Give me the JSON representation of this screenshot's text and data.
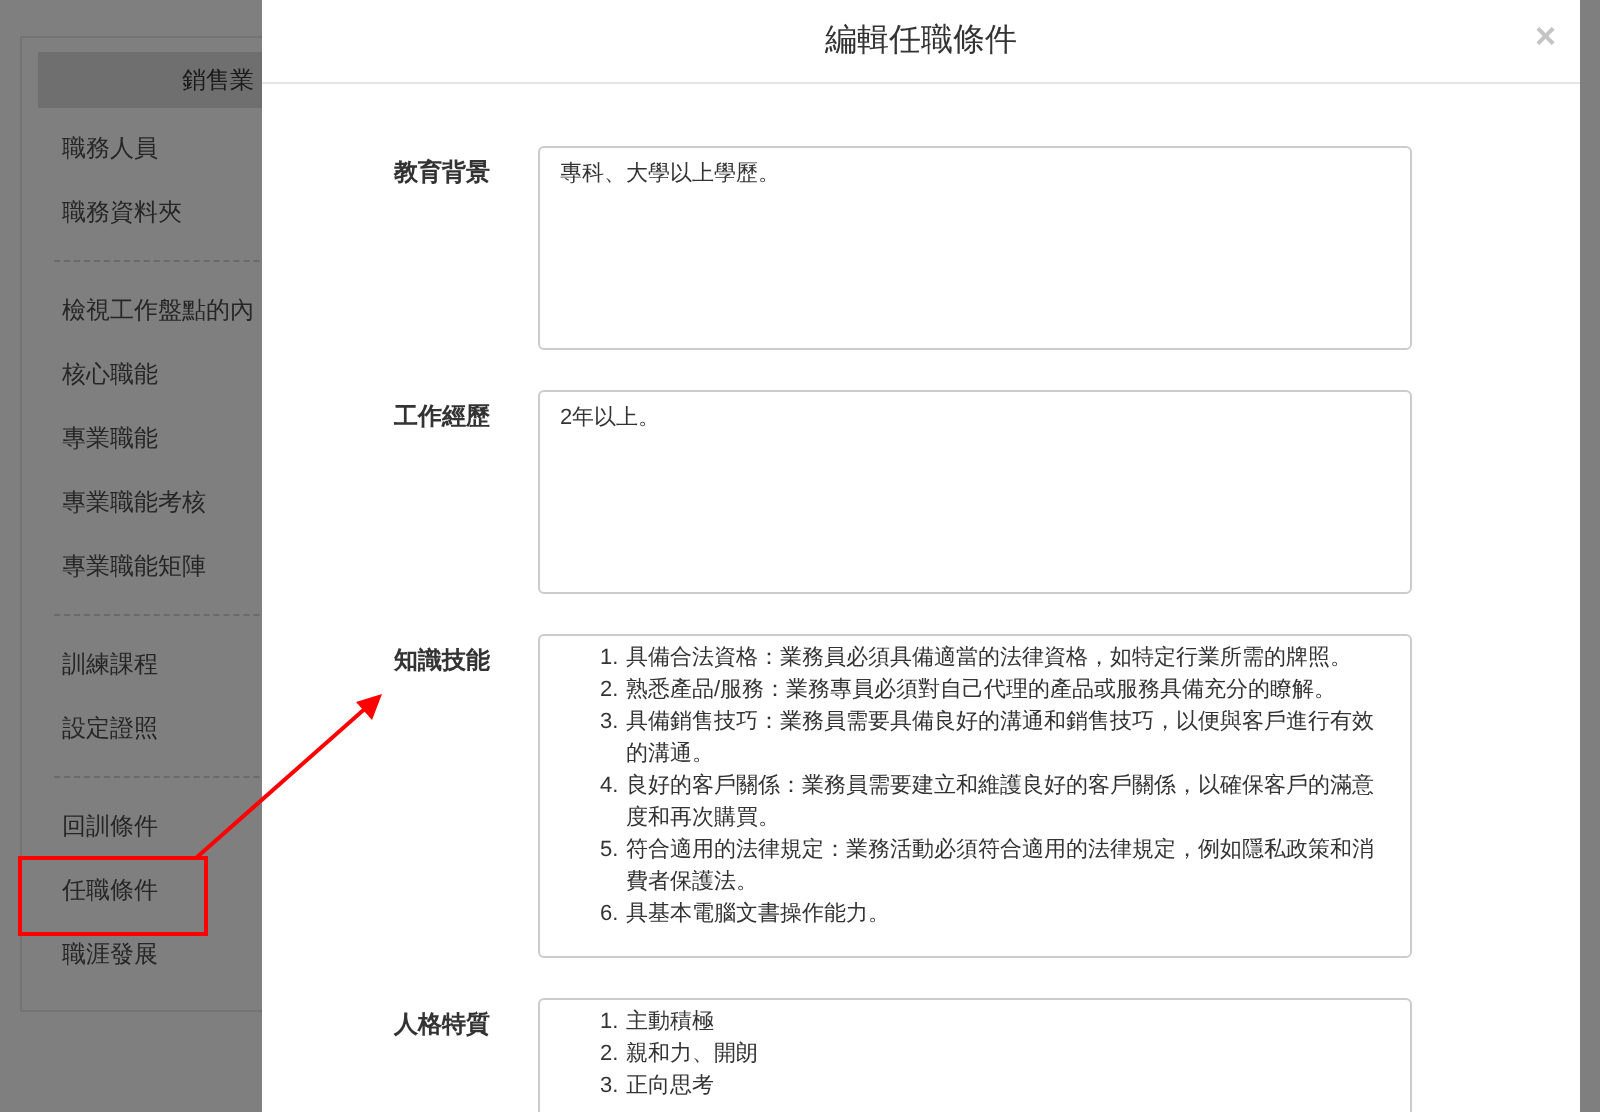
{
  "sidebar": {
    "header": "銷售業",
    "groups": [
      {
        "items": [
          {
            "label": "職務人員"
          },
          {
            "label": "職務資料夾"
          }
        ]
      },
      {
        "items": [
          {
            "label": "檢視工作盤點的內"
          },
          {
            "label": "核心職能"
          },
          {
            "label": "專業職能"
          },
          {
            "label": "專業職能考核"
          },
          {
            "label": "專業職能矩陣"
          }
        ]
      },
      {
        "items": [
          {
            "label": "訓練課程"
          },
          {
            "label": "設定證照"
          }
        ]
      },
      {
        "items": [
          {
            "label": "回訓條件"
          },
          {
            "label": "任職條件"
          },
          {
            "label": "職涯發展"
          }
        ]
      }
    ]
  },
  "modal": {
    "title": "編輯任職條件",
    "close": "×",
    "fields": [
      {
        "label": "教育背景",
        "kind": "text",
        "value": "專科、大學以上學歷。"
      },
      {
        "label": "工作經歷",
        "kind": "text",
        "value": "2年以上。"
      },
      {
        "label": "知識技能",
        "kind": "list",
        "items": [
          {
            "number": "1.",
            "text": "具備合法資格：業務員必須具備適當的法律資格，如特定行業所需的牌照。"
          },
          {
            "number": "2.",
            "text": "熟悉產品/服務：業務專員必須對自己代理的產品或服務具備充分的瞭解。"
          },
          {
            "number": "3.",
            "text": "具備銷售技巧：業務員需要具備良好的溝通和銷售技巧，以便與客戶進行有效的溝通。"
          },
          {
            "number": "4.",
            "text": "良好的客戶關係：業務員需要建立和維護良好的客戶關係，以確保客戶的滿意度和再次購買。"
          },
          {
            "number": "5.",
            "text": "符合適用的法律規定：業務活動必須符合適用的法律規定，例如隱私政策和消費者保護法。"
          },
          {
            "number": "6.",
            "text": "具基本電腦文書操作能力。"
          }
        ]
      },
      {
        "label": "人格特質",
        "kind": "list",
        "items": [
          {
            "number": "1.",
            "text": "主動積極"
          },
          {
            "number": "2.",
            "text": "親和力、開朗"
          },
          {
            "number": "3.",
            "text": "正向思考"
          }
        ]
      }
    ]
  }
}
